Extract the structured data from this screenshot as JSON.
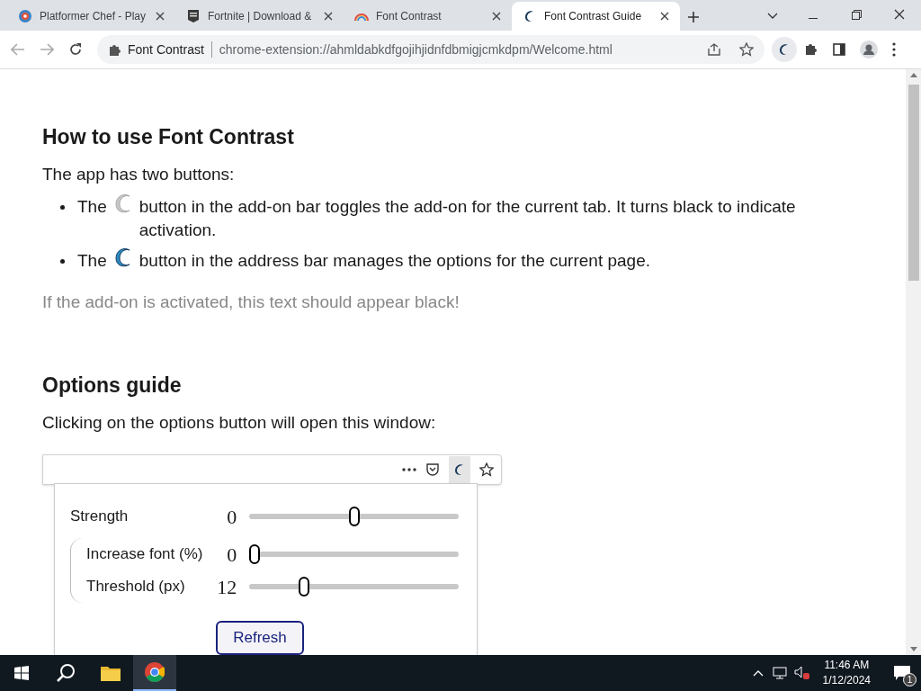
{
  "tabs": [
    {
      "title": "Platformer Chef - Play",
      "selected": false
    },
    {
      "title": "Fortnite | Download &",
      "selected": false
    },
    {
      "title": "Font Contrast",
      "selected": false
    },
    {
      "title": "Font Contrast Guide",
      "selected": true
    }
  ],
  "address_bar": {
    "site_label": "Font Contrast",
    "url": "chrome-extension://ahmldabkdfgojihjidnfdbmigjcmkdpm/Welcome.html"
  },
  "page": {
    "heading_1": "How to use Font Contrast",
    "intro": "The app has two buttons:",
    "bullets": [
      {
        "before": "The",
        "after": "button in the add-on bar toggles the add-on for the current tab. It turns black to indicate activation."
      },
      {
        "before": "The",
        "after": "button in the address bar manages the options for the current page."
      }
    ],
    "note": "If the add-on is activated, this text should appear black!",
    "heading_2": "Options guide",
    "options_intro": "Clicking on the options button will open this window:",
    "popup": {
      "rows": [
        {
          "label": "Strength",
          "value": "0",
          "level": 0.5,
          "nested": false
        },
        {
          "label": "Increase font (%)",
          "value": "0",
          "level": 0,
          "nested": true
        },
        {
          "label": "Threshold (px)",
          "value": "12",
          "level": 0.25,
          "nested": true
        }
      ],
      "button": "Refresh"
    }
  },
  "taskbar": {
    "time": "11:46 AM",
    "date": "1/12/2024",
    "notifications": "1"
  }
}
